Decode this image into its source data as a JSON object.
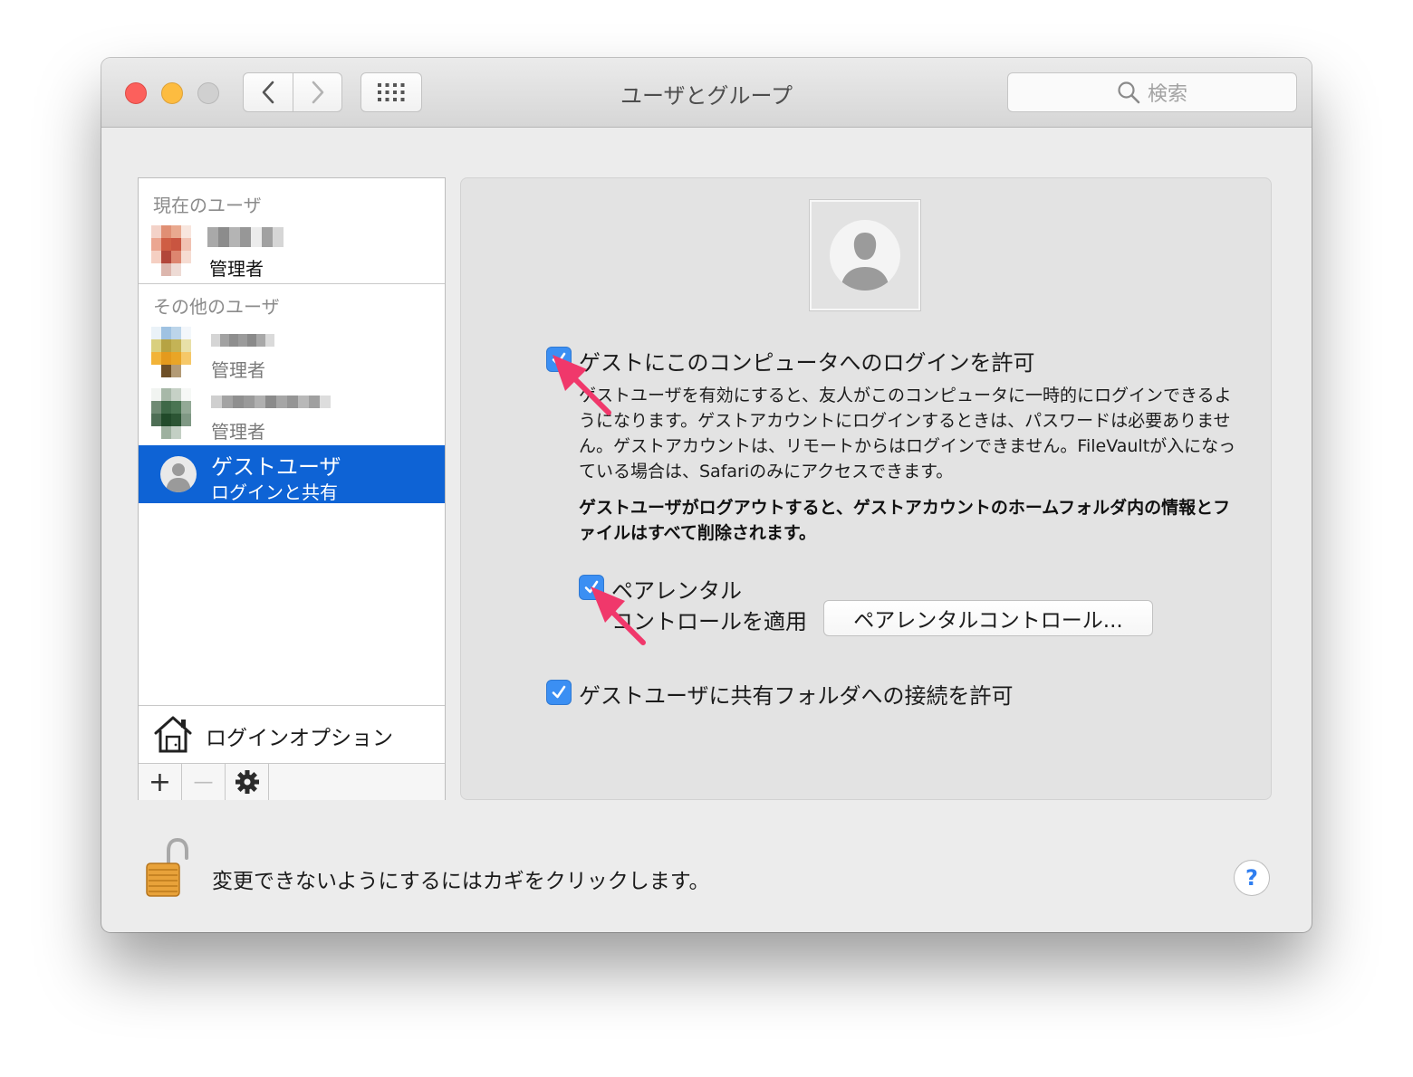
{
  "window": {
    "title": "ユーザとグループ",
    "search_placeholder": "検索"
  },
  "sidebar": {
    "current_section": "現在のユーザ",
    "current_user": {
      "name": "",
      "role": "管理者"
    },
    "other_section": "その他のユーザ",
    "other_users": [
      {
        "name": "",
        "role": "管理者"
      },
      {
        "name": "",
        "role": "管理者"
      }
    ],
    "guest": {
      "name": "ゲストユーザ",
      "role": "ログインと共有"
    },
    "login_options": "ログインオプション",
    "toolbar": {
      "add": "+",
      "remove": "—"
    }
  },
  "main": {
    "allow_guest_login": {
      "label": "ゲストにこのコンピュータへのログインを許可",
      "checked": true
    },
    "description": "ゲストユーザを有効にすると、友人がこのコンピュータに一時的にログインできるようになります。ゲストアカウントにログインするときは、パスワードは必要ありません。ゲストアカウントは、リモートからはログインできません。FileVaultが入になっている場合は、Safariのみにアクセスできます。",
    "warning": "ゲストユーザがログアウトすると、ゲストアカウントのホームフォルダ内の情報とファイルはすべて削除されます。",
    "parental": {
      "label_line1": "ペアレンタル",
      "label_line2": "コントロールを適用",
      "checked": true
    },
    "parental_button": "ペアレンタルコントロール...",
    "shared_folders": {
      "label": "ゲストユーザに共有フォルダへの接続を許可",
      "checked": true
    }
  },
  "footer": {
    "lock_text": "変更できないようにするにはカギをクリックします。",
    "help": "?"
  },
  "colors": {
    "accent": "#0e63d5",
    "checkbox": "#3b8ff3",
    "annotation_arrow": "#f0386b"
  }
}
